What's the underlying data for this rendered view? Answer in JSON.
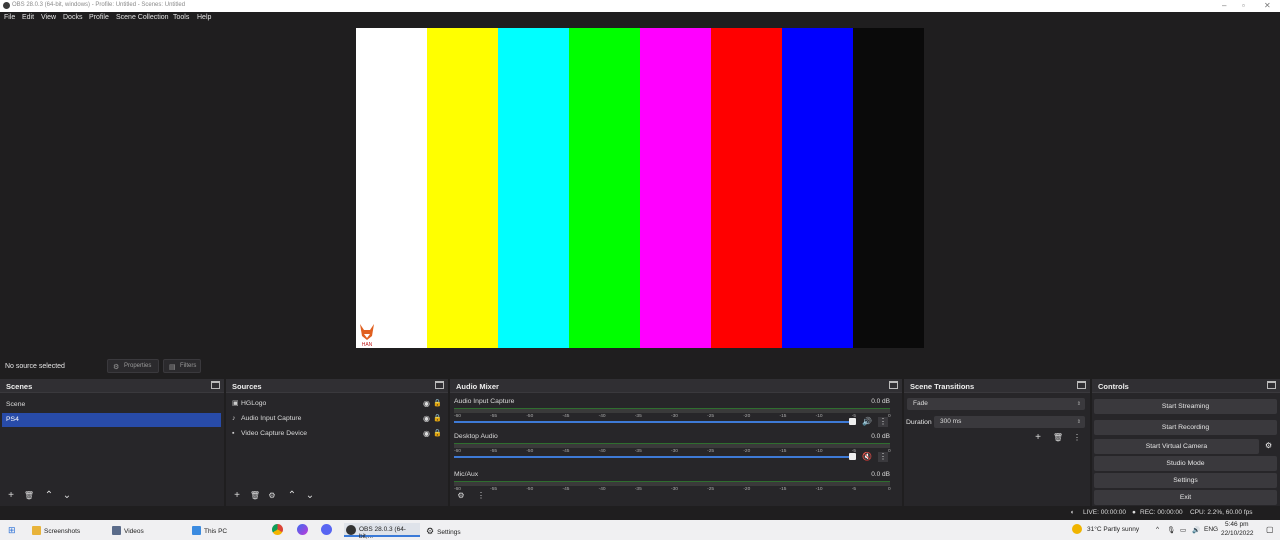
{
  "window": {
    "title": "OBS 28.0.3 (64-bit, windows) - Profile: Untitled - Scenes: Untitled"
  },
  "menu": [
    "File",
    "Edit",
    "View",
    "Docks",
    "Profile",
    "Scene Collection",
    "Tools",
    "Help"
  ],
  "preview": {
    "bar_colors": [
      "#ffffff",
      "#ffff00",
      "#00ffff",
      "#00ff00",
      "#ff00ff",
      "#ff0000",
      "#0000ff",
      "#0a0a0a"
    ],
    "logo_text": "HAN"
  },
  "source_toolbar": {
    "status": "No source selected",
    "properties": "Properties",
    "filters": "Filters"
  },
  "scenes": {
    "title": "Scenes",
    "items": [
      {
        "label": "Scene"
      },
      {
        "label": "PS4",
        "selected": true
      }
    ]
  },
  "sources": {
    "title": "Sources",
    "items": [
      {
        "label": "HGLogo",
        "icon": "image-icon"
      },
      {
        "label": "Audio Input Capture",
        "icon": "microphone-icon"
      },
      {
        "label": "Video Capture Device",
        "icon": "camera-icon"
      }
    ]
  },
  "mixer": {
    "title": "Audio Mixer",
    "scale": [
      "-60",
      "-55",
      "-50",
      "-45",
      "-40",
      "-35",
      "-30",
      "-25",
      "-20",
      "-15",
      "-10",
      "-5",
      "0"
    ],
    "channels": [
      {
        "name": "Audio Input Capture",
        "db": "0.0 dB",
        "muted": false
      },
      {
        "name": "Desktop Audio",
        "db": "0.0 dB",
        "muted": true
      },
      {
        "name": "Mic/Aux",
        "db": "0.0 dB",
        "muted": false
      }
    ]
  },
  "transitions": {
    "title": "Scene Transitions",
    "selected": "Fade",
    "duration_label": "Duration",
    "duration_value": "300 ms"
  },
  "controls": {
    "title": "Controls",
    "start_streaming": "Start Streaming",
    "start_recording": "Start Recording",
    "start_virtual_camera": "Start Virtual Camera",
    "studio_mode": "Studio Mode",
    "settings": "Settings",
    "exit": "Exit"
  },
  "status": {
    "live": "LIVE: 00:00:00",
    "rec": "REC: 00:00:00",
    "cpu": "CPU: 2.2%, 60.00 fps"
  },
  "taskbar": {
    "apps": [
      {
        "label": "Screenshots",
        "color": "#e8b33a"
      },
      {
        "label": "Videos",
        "color": "#5a6b8a"
      },
      {
        "label": "This PC",
        "color": "#3b8be0"
      }
    ],
    "obs": "OBS 28.0.3 (64-bit,...",
    "settings": "Settings",
    "weather": "31°C  Partly sunny",
    "lang": "ENG",
    "time": "5:46 pm",
    "date": "22/10/2022"
  }
}
